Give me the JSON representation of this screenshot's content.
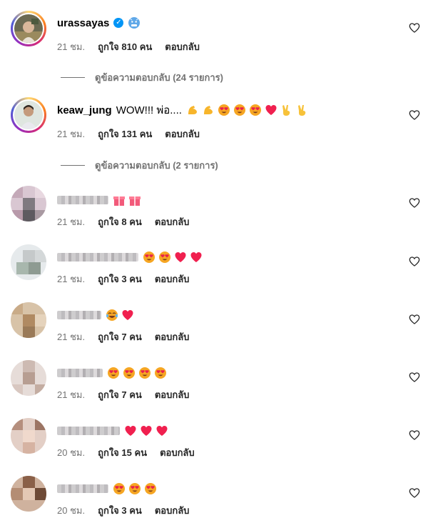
{
  "comments": [
    {
      "username": "urassayas",
      "verified": true,
      "text": "",
      "emojis": [
        "cold-face"
      ],
      "time": "21 ชม.",
      "likes": "ถูกใจ 810 คน",
      "reply": "ตอบกลับ",
      "view_replies": "ดูข้อความตอบกลับ (24 รายการ)"
    },
    {
      "username": "keaw_jung",
      "verified": false,
      "text": "WOW!!! พ่อ....",
      "emojis": [
        "muscle",
        "muscle",
        "heart-eyes",
        "heart-eyes",
        "heart-eyes",
        "red-heart",
        "victory",
        "victory"
      ],
      "time": "21 ชม.",
      "likes": "ถูกใจ 131 คน",
      "reply": "ตอบกลับ",
      "view_replies": "ดูข้อความตอบกลับ (2 รายการ)"
    },
    {
      "username": "",
      "text": "",
      "emojis": [
        "gift",
        "gift"
      ],
      "time": "21 ชม.",
      "likes": "ถูกใจ 8 คน",
      "reply": "ตอบกลับ"
    },
    {
      "username": "",
      "text": "",
      "emojis": [
        "heart-eyes",
        "heart-eyes",
        "red-heart",
        "red-heart"
      ],
      "time": "21 ชม.",
      "likes": "ถูกใจ 3 คน",
      "reply": "ตอบกลับ"
    },
    {
      "username": "",
      "text": "",
      "emojis": [
        "tears-of-joy",
        "red-heart"
      ],
      "time": "21 ชม.",
      "likes": "ถูกใจ 7 คน",
      "reply": "ตอบกลับ"
    },
    {
      "username": "",
      "text": "",
      "emojis": [
        "heart-eyes",
        "heart-eyes",
        "heart-eyes",
        "heart-eyes"
      ],
      "time": "21 ชม.",
      "likes": "ถูกใจ 7 คน",
      "reply": "ตอบกลับ"
    },
    {
      "username": "",
      "text": "",
      "emojis": [
        "red-heart",
        "red-heart",
        "red-heart"
      ],
      "time": "20 ชม.",
      "likes": "ถูกใจ 15 คน",
      "reply": "ตอบกลับ"
    },
    {
      "username": "",
      "text": "",
      "emojis": [
        "heart-eyes",
        "heart-eyes",
        "heart-eyes"
      ],
      "time": "20 ชม.",
      "likes": "ถูกใจ 3 คน",
      "reply": "ตอบกลับ"
    }
  ],
  "icons": {
    "like": "heart-outline-icon",
    "verified": "verified-badge-icon"
  },
  "colors": {
    "secondary_text": "#737373",
    "verified_blue": "#0095f6",
    "heart_red": "#ff3040"
  }
}
